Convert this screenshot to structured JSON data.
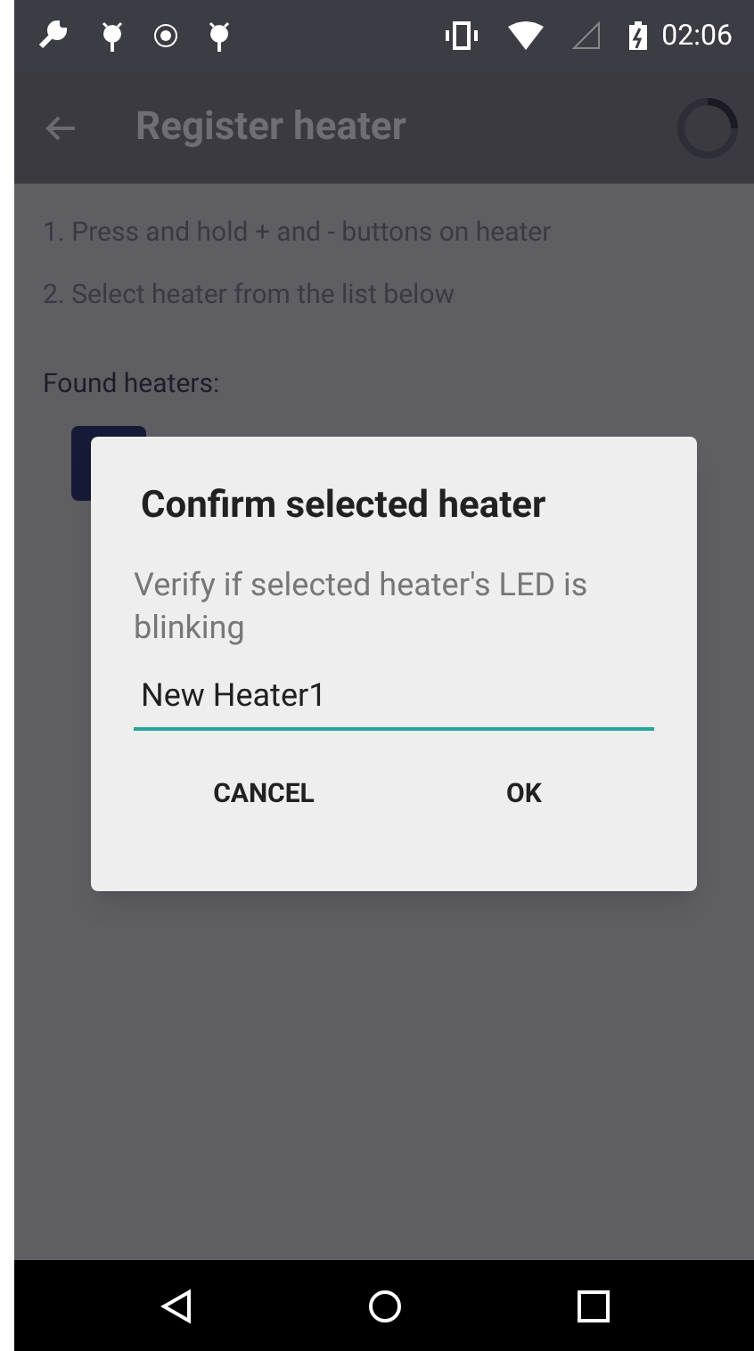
{
  "status_bar": {
    "time": "02:06"
  },
  "app_bar": {
    "title": "Register heater",
    "loading": true
  },
  "instructions": [
    "1. Press and hold + and - buttons on heater",
    "2. Select heater from the list below"
  ],
  "found_label": "Found heaters:",
  "dialog": {
    "title": "Confirm selected heater",
    "message": "Verify if selected heater's LED is blinking",
    "field_value": "New Heater1",
    "buttons": [
      "CANCEL",
      "OK"
    ]
  }
}
